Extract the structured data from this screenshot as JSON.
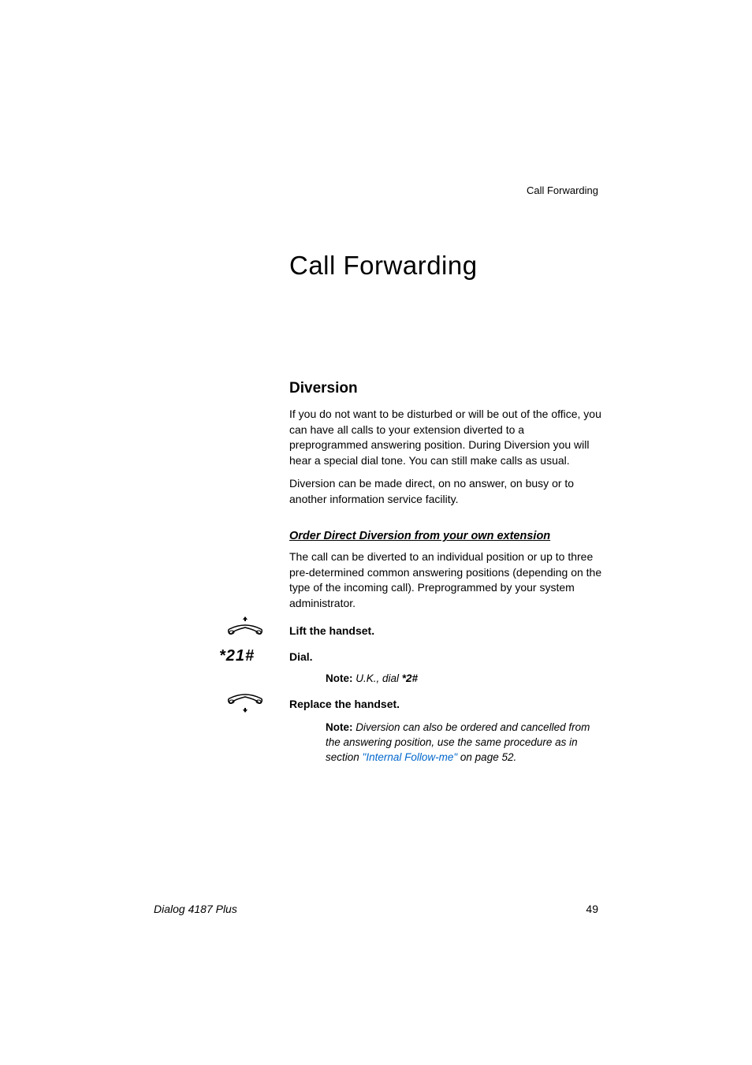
{
  "header": {
    "breadcrumb": "Call Forwarding"
  },
  "main": {
    "title": "Call Forwarding",
    "section_title": "Diversion",
    "para1": "If you do not want to be disturbed or will be out of the office, you can have all calls to your extension diverted to a preprogrammed answering position. During Diversion you will hear a special dial tone. You can still make calls as usual.",
    "para2": "Diversion can be made direct, on no answer, on busy or to another information service facility.",
    "subsection_title": "Order Direct Diversion from your own extension",
    "para3": "The call can be diverted to an individual position or up to three pre-determined common answering positions (depending on the type of the incoming call). Preprogrammed by your system administrator."
  },
  "steps": {
    "lift_label": "Lift the handset.",
    "dial_code": "*21#",
    "dial_label": "Dial.",
    "note1_bold": "Note:",
    "note1_prefix": " U.K., dial ",
    "note1_code": "*2#",
    "replace_label": "Replace the handset.",
    "note2_bold": "Note:",
    "note2_text1": " Diversion can also be ordered and cancelled from the answering position, use the same procedure as in section ",
    "note2_link": "\"Internal Follow-me\"",
    "note2_text2": " on page 52."
  },
  "footer": {
    "left": "Dialog 4187 Plus",
    "right": "49"
  }
}
